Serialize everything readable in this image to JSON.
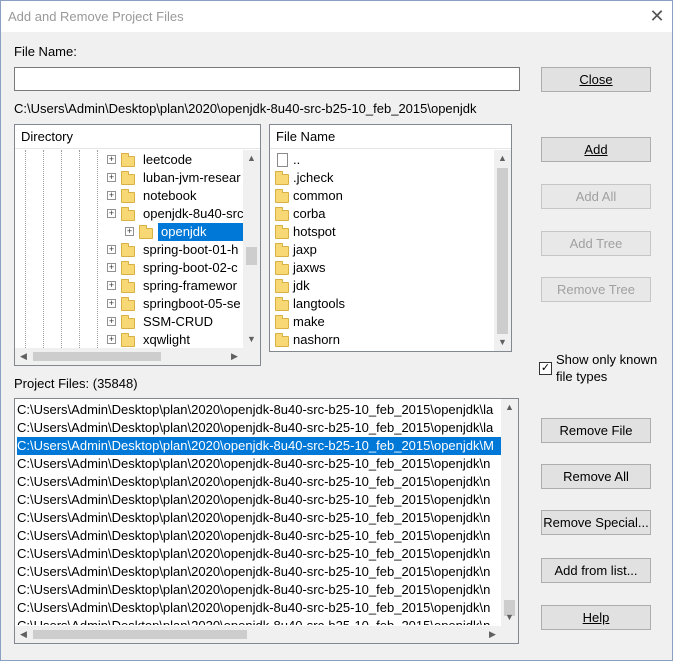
{
  "window": {
    "title": "Add and Remove Project Files",
    "close_glyph": "✕"
  },
  "file_name": {
    "label": "File Name:",
    "value": "",
    "current_path": "C:\\Users\\Admin\\Desktop\\plan\\2020\\openjdk-8u40-src-b25-10_feb_2015\\openjdk"
  },
  "directory": {
    "header": "Directory",
    "items": [
      {
        "label": "leetcode"
      },
      {
        "label": "luban-jvm-resear"
      },
      {
        "label": "notebook"
      },
      {
        "label": "openjdk-8u40-src"
      },
      {
        "label": "openjdk",
        "selected": true
      },
      {
        "label": "spring-boot-01-h"
      },
      {
        "label": "spring-boot-02-c"
      },
      {
        "label": "spring-framewor"
      },
      {
        "label": "springboot-05-se"
      },
      {
        "label": "SSM-CRUD"
      },
      {
        "label": "xqwlight"
      }
    ]
  },
  "file_list": {
    "header": "File Name",
    "items": [
      {
        "label": "..",
        "icon": "file-icon"
      },
      {
        "label": ".jcheck",
        "icon": "folder-icon"
      },
      {
        "label": "common",
        "icon": "folder-icon"
      },
      {
        "label": "corba",
        "icon": "folder-icon"
      },
      {
        "label": "hotspot",
        "icon": "folder-icon"
      },
      {
        "label": "jaxp",
        "icon": "folder-icon"
      },
      {
        "label": "jaxws",
        "icon": "folder-icon"
      },
      {
        "label": "jdk",
        "icon": "folder-icon"
      },
      {
        "label": "langtools",
        "icon": "folder-icon"
      },
      {
        "label": "make",
        "icon": "folder-icon"
      },
      {
        "label": "nashorn",
        "icon": "folder-icon"
      }
    ]
  },
  "buttons": {
    "close": "Close",
    "add": "Add",
    "add_all": "Add All",
    "add_tree": "Add Tree",
    "remove_tree": "Remove Tree",
    "remove_file": "Remove File",
    "remove_all": "Remove All",
    "remove_special": "Remove Special...",
    "add_from_list": "Add from list...",
    "help": "Help"
  },
  "show_known": {
    "label_line1": "Show only known",
    "label_line2": "file types",
    "checked": "✓"
  },
  "project_files": {
    "label": "Project Files: (35848)",
    "rows": [
      {
        "text": "C:\\Users\\Admin\\Desktop\\plan\\2020\\openjdk-8u40-src-b25-10_feb_2015\\openjdk\\la"
      },
      {
        "text": "C:\\Users\\Admin\\Desktop\\plan\\2020\\openjdk-8u40-src-b25-10_feb_2015\\openjdk\\la"
      },
      {
        "text": "C:\\Users\\Admin\\Desktop\\plan\\2020\\openjdk-8u40-src-b25-10_feb_2015\\openjdk\\M",
        "selected": true
      },
      {
        "text": "C:\\Users\\Admin\\Desktop\\plan\\2020\\openjdk-8u40-src-b25-10_feb_2015\\openjdk\\n"
      },
      {
        "text": "C:\\Users\\Admin\\Desktop\\plan\\2020\\openjdk-8u40-src-b25-10_feb_2015\\openjdk\\n"
      },
      {
        "text": "C:\\Users\\Admin\\Desktop\\plan\\2020\\openjdk-8u40-src-b25-10_feb_2015\\openjdk\\n"
      },
      {
        "text": "C:\\Users\\Admin\\Desktop\\plan\\2020\\openjdk-8u40-src-b25-10_feb_2015\\openjdk\\n"
      },
      {
        "text": "C:\\Users\\Admin\\Desktop\\plan\\2020\\openjdk-8u40-src-b25-10_feb_2015\\openjdk\\n"
      },
      {
        "text": "C:\\Users\\Admin\\Desktop\\plan\\2020\\openjdk-8u40-src-b25-10_feb_2015\\openjdk\\n"
      },
      {
        "text": "C:\\Users\\Admin\\Desktop\\plan\\2020\\openjdk-8u40-src-b25-10_feb_2015\\openjdk\\n"
      },
      {
        "text": "C:\\Users\\Admin\\Desktop\\plan\\2020\\openjdk-8u40-src-b25-10_feb_2015\\openjdk\\n"
      },
      {
        "text": "C:\\Users\\Admin\\Desktop\\plan\\2020\\openjdk-8u40-src-b25-10_feb_2015\\openjdk\\n"
      },
      {
        "text": "C:\\Users\\Admin\\Desktop\\plan\\2020\\openjdk-8u40-src-b25-10_feb_2015\\openjdk\\n"
      }
    ]
  },
  "colors": {
    "selection": "#0078d7",
    "folder": "#f8d775",
    "button_face": "#e1e1e1"
  }
}
